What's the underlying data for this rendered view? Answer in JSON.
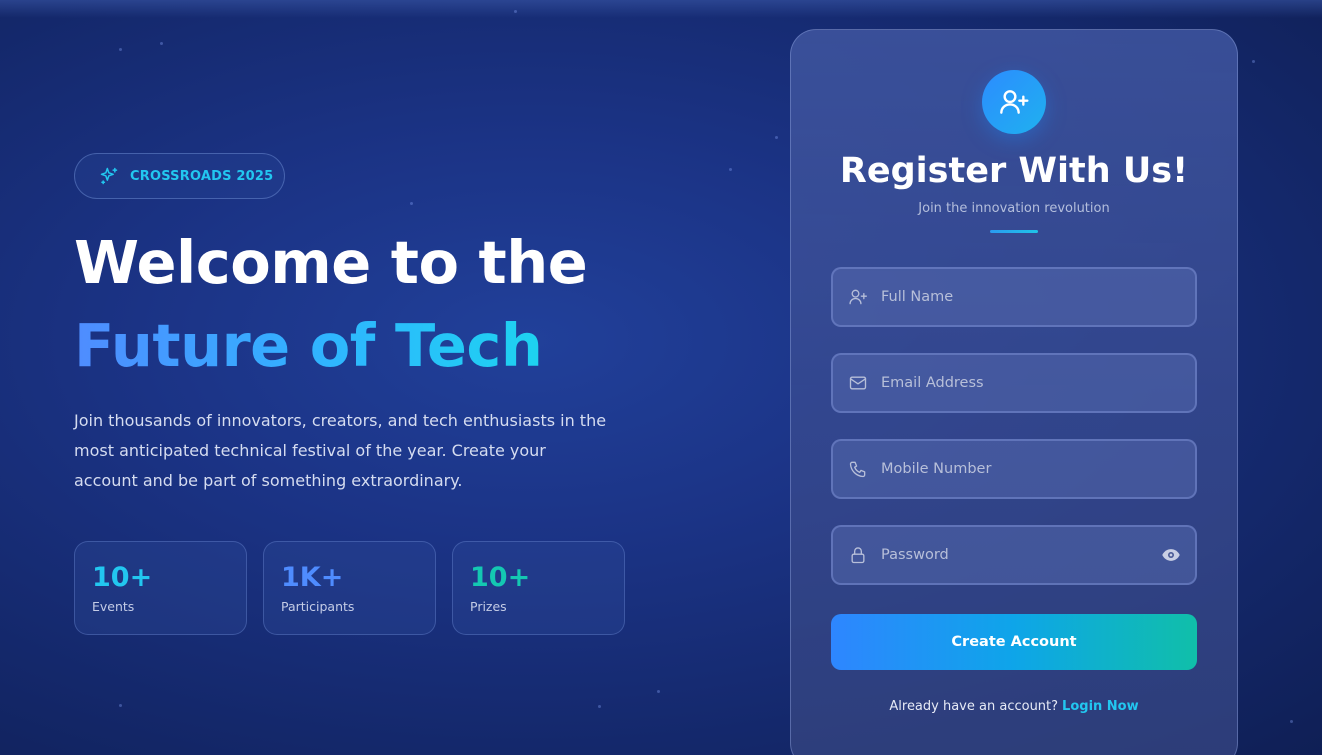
{
  "hero": {
    "badge": "CROSSROADS 2025",
    "headline_line1": "Welcome to the",
    "headline_line2": "Future of Tech",
    "description": "Join thousands of innovators, creators, and tech enthusiasts in the most anticipated technical festival of the year. Create your account and be part of something extraordinary.",
    "stats": [
      {
        "value": "10+",
        "label": "Events",
        "color": "#22c7f0"
      },
      {
        "value": "1K+",
        "label": "Participants",
        "color": "#4f8cff"
      },
      {
        "value": "10+",
        "label": "Prizes",
        "color": "#14c8b2"
      }
    ]
  },
  "register": {
    "icon": "user-plus-icon",
    "title": "Register With Us!",
    "subtitle": "Join the innovation revolution",
    "fields": {
      "full_name": {
        "placeholder": "Full Name",
        "icon": "user-plus-icon"
      },
      "email": {
        "placeholder": "Email Address",
        "icon": "mail-icon"
      },
      "mobile": {
        "placeholder": "Mobile Number",
        "icon": "phone-icon"
      },
      "password": {
        "placeholder": "Password",
        "icon": "lock-icon"
      }
    },
    "submit_label": "Create Account",
    "footer_text": "Already have an account?",
    "login_link": "Login Now"
  },
  "colors": {
    "accent_cyan": "#22c7f0",
    "accent_blue": "#4f8cff",
    "accent_teal": "#14c8b2"
  }
}
